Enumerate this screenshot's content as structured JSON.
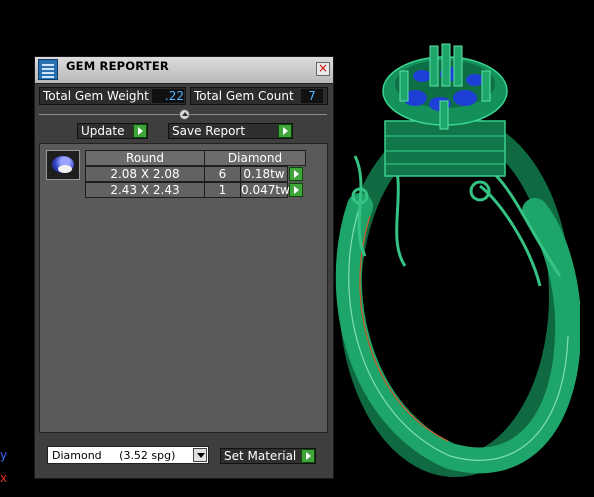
{
  "window": {
    "title": "GEM REPORTER",
    "close_icon": "close-icon"
  },
  "summary": {
    "weight_label": "Total Gem Weight",
    "weight_value": ".22",
    "count_label": "Total Gem Count",
    "count_value": "7"
  },
  "toolbar": {
    "update_label": "Update",
    "save_report_label": "Save Report"
  },
  "gem_group": {
    "thumbnail_icon": "round-gem-icon",
    "shape_header": "Round",
    "material_header": "Diamond",
    "rows": [
      {
        "size": "2.08 X 2.08",
        "count": "6",
        "weight": "0.18tw"
      },
      {
        "size": "2.43 X 2.43",
        "count": "1",
        "weight": "0.047tw"
      }
    ]
  },
  "material": {
    "selected": "Diamond     (3.52 spg)",
    "set_label": "Set Material"
  },
  "viewport": {
    "axis_y_label": "y",
    "axis_x_label": "x",
    "ring_color": "#1ea66a",
    "gem_color": "#1d3fd6",
    "accent_green": "#3fa53a",
    "value_blue": "#4fb4ff"
  }
}
